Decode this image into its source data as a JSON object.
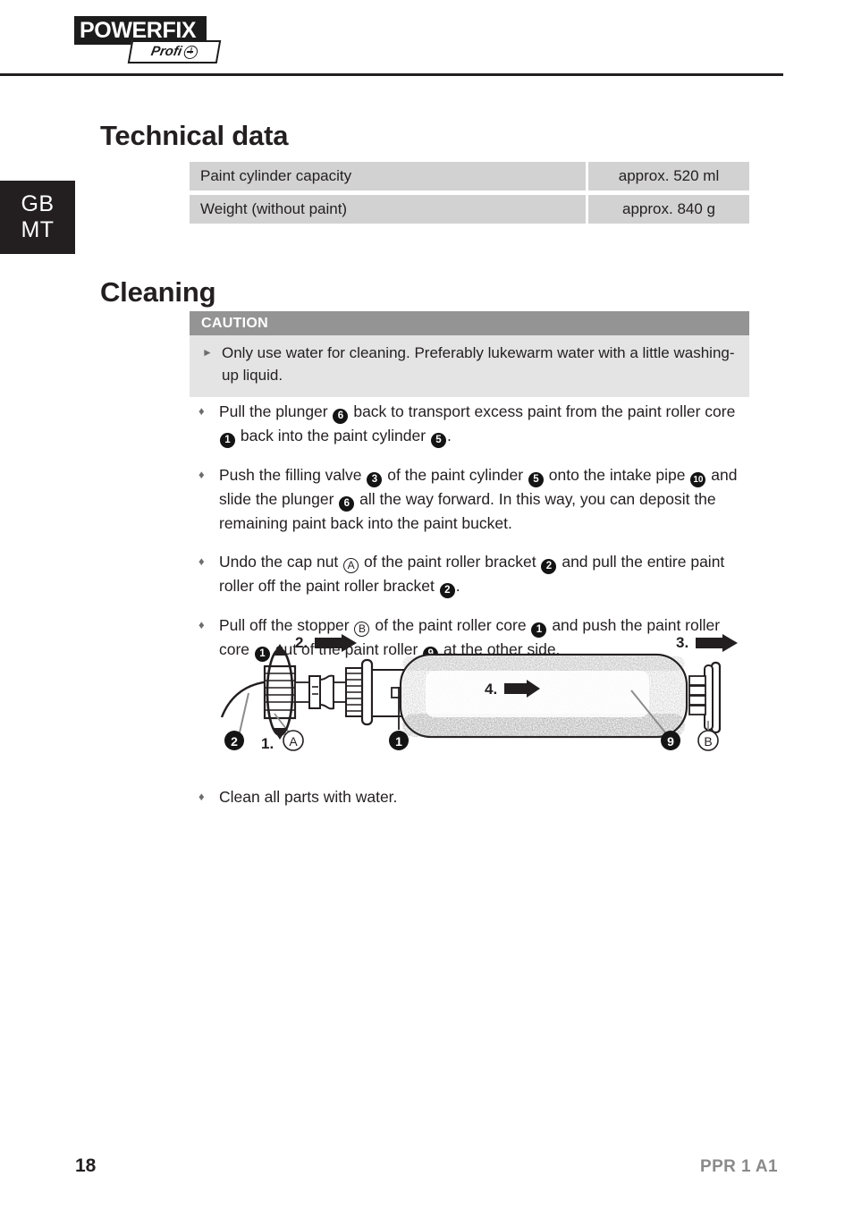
{
  "brand": {
    "name": "POWERFIX",
    "registered": "®",
    "badge_text": "Profi",
    "badge_icon": "plus-circle-icon"
  },
  "language_tab": {
    "line1": "GB",
    "line2": "MT"
  },
  "sections": {
    "technical_data": {
      "heading": "Technical data",
      "table": {
        "rows": [
          {
            "label": "Paint cylinder capacity",
            "value": "approx. 520 ml"
          },
          {
            "label": "Weight (without paint)",
            "value": "approx. 840 g"
          }
        ]
      }
    },
    "cleaning": {
      "heading": "Cleaning",
      "caution": {
        "title": "CAUTION",
        "bullet_glyph": "►",
        "text": "Only use water for cleaning. Preferably lukewarm water with a little washing-up liquid."
      },
      "bullet_glyph": "♦",
      "items": [
        {
          "parts": [
            {
              "t": "text",
              "v": "Pull the plunger "
            },
            {
              "t": "ref",
              "v": "6"
            },
            {
              "t": "text",
              "v": " back to transport excess paint from the paint roller core "
            },
            {
              "t": "ref",
              "v": "1"
            },
            {
              "t": "text",
              "v": " back into the paint cylinder "
            },
            {
              "t": "ref",
              "v": "5"
            },
            {
              "t": "text",
              "v": "."
            }
          ]
        },
        {
          "parts": [
            {
              "t": "text",
              "v": "Push the filling valve "
            },
            {
              "t": "ref",
              "v": "3"
            },
            {
              "t": "text",
              "v": " of the paint cylinder "
            },
            {
              "t": "ref",
              "v": "5"
            },
            {
              "t": "text",
              "v": " onto the intake pipe "
            },
            {
              "t": "ref",
              "v": "10"
            },
            {
              "t": "text",
              "v": " and slide the plunger "
            },
            {
              "t": "ref",
              "v": "6"
            },
            {
              "t": "text",
              "v": " all the way forward. In this way, you can deposit the remaining paint back into the paint bucket."
            }
          ]
        },
        {
          "parts": [
            {
              "t": "text",
              "v": "Undo the cap nut "
            },
            {
              "t": "letter",
              "v": "A"
            },
            {
              "t": "text",
              "v": " of the paint roller bracket "
            },
            {
              "t": "ref",
              "v": "2"
            },
            {
              "t": "text",
              "v": " and pull the entire paint roller off the paint roller bracket "
            },
            {
              "t": "ref",
              "v": "2"
            },
            {
              "t": "text",
              "v": "."
            }
          ]
        },
        {
          "parts": [
            {
              "t": "text",
              "v": "Pull off the stopper "
            },
            {
              "t": "letter",
              "v": "B"
            },
            {
              "t": "text",
              "v": " of the paint roller core "
            },
            {
              "t": "ref",
              "v": "1"
            },
            {
              "t": "text",
              "v": " and push the paint roller core "
            },
            {
              "t": "ref",
              "v": "1"
            },
            {
              "t": "text",
              "v": " out of the paint roller "
            },
            {
              "t": "ref",
              "v": "9"
            },
            {
              "t": "text",
              "v": " at the other side."
            }
          ]
        }
      ],
      "final_item": "Clean all parts with water."
    }
  },
  "diagram": {
    "name": "paint-roller-disassembly-diagram",
    "step_labels": [
      "1.",
      "2.",
      "3.",
      "4."
    ],
    "callouts": [
      {
        "id": "2",
        "type": "number",
        "meaning": "paint-roller-bracket"
      },
      {
        "id": "A",
        "type": "letter",
        "meaning": "cap-nut"
      },
      {
        "id": "1",
        "type": "number",
        "meaning": "paint-roller-core"
      },
      {
        "id": "9",
        "type": "number",
        "meaning": "paint-roller"
      },
      {
        "id": "B",
        "type": "letter",
        "meaning": "stopper"
      }
    ]
  },
  "footer": {
    "page_number": "18",
    "model": "PPR 1 A1"
  },
  "colors": {
    "ink": "#231f20",
    "table_fill": "#d2d2d2",
    "caution_header": "#949494",
    "caution_body": "#e4e4e4",
    "bullet_gray": "#6d6d6d",
    "footer_model": "#8a8a8a"
  }
}
